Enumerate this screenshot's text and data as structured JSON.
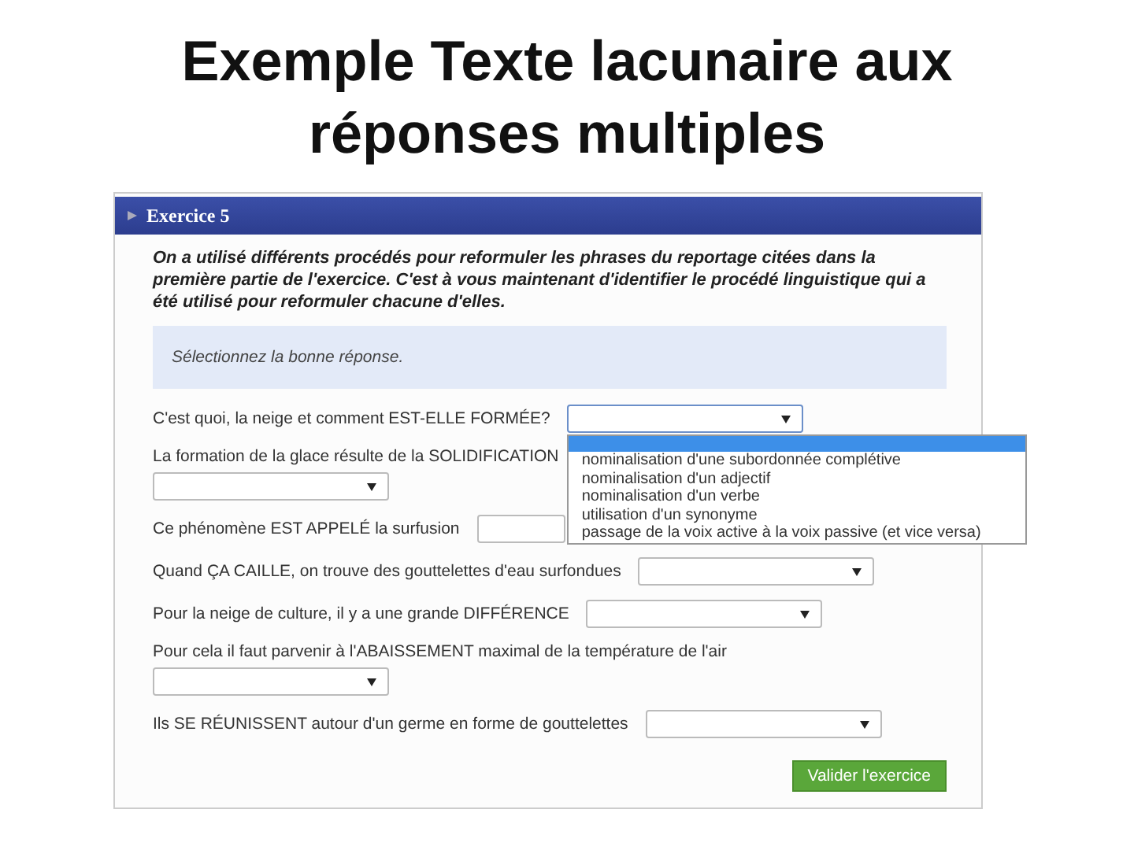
{
  "slide_title": "Exemple Texte lacunaire aux réponses multiples",
  "exercise": {
    "title": "Exercice 5",
    "instruction": "On a utilisé différents procédés pour reformuler les phrases du reportage citées dans la première partie de l'exercice. C'est à vous maintenant d'identifier le procédé linguistique qui a été utilisé pour reformuler chacune d'elles.",
    "hint": "Sélectionnez la bonne réponse.",
    "questions": [
      {
        "text": "C'est quoi, la neige et comment EST-ELLE FORMÉE?",
        "kind": "inline",
        "open": true
      },
      {
        "text": "La formation de la glace résulte de la SOLIDIFICATION",
        "kind": "below",
        "open": false
      },
      {
        "text": "Ce phénomène EST APPELÉ la surfusion",
        "kind": "short",
        "open": false
      },
      {
        "text": "Quand ÇA CAILLE, on trouve des gouttelettes d'eau surfondues",
        "kind": "inline",
        "open": false
      },
      {
        "text": "Pour la neige de culture, il y a une grande DIFFÉRENCE",
        "kind": "inline",
        "open": false
      },
      {
        "text": "Pour cela il faut parvenir à l'ABAISSEMENT maximal de la température de l'air",
        "kind": "below",
        "open": false
      },
      {
        "text": "Ils SE RÉUNISSENT autour d'un germe en forme de gouttelettes",
        "kind": "inline",
        "open": false
      }
    ],
    "dropdown": {
      "blank_selected": true,
      "options": [
        {
          "label": "nominalisation d'une subordonnée complétive"
        },
        {
          "label": "nominalisation d'un adjectif"
        },
        {
          "label": "nominalisation d'un verbe"
        },
        {
          "label": "utilisation d'un synonyme"
        },
        {
          "label": "passage de la voix active à la voix passive (et vice versa)"
        }
      ]
    },
    "submit": "Valider l'exercice"
  }
}
